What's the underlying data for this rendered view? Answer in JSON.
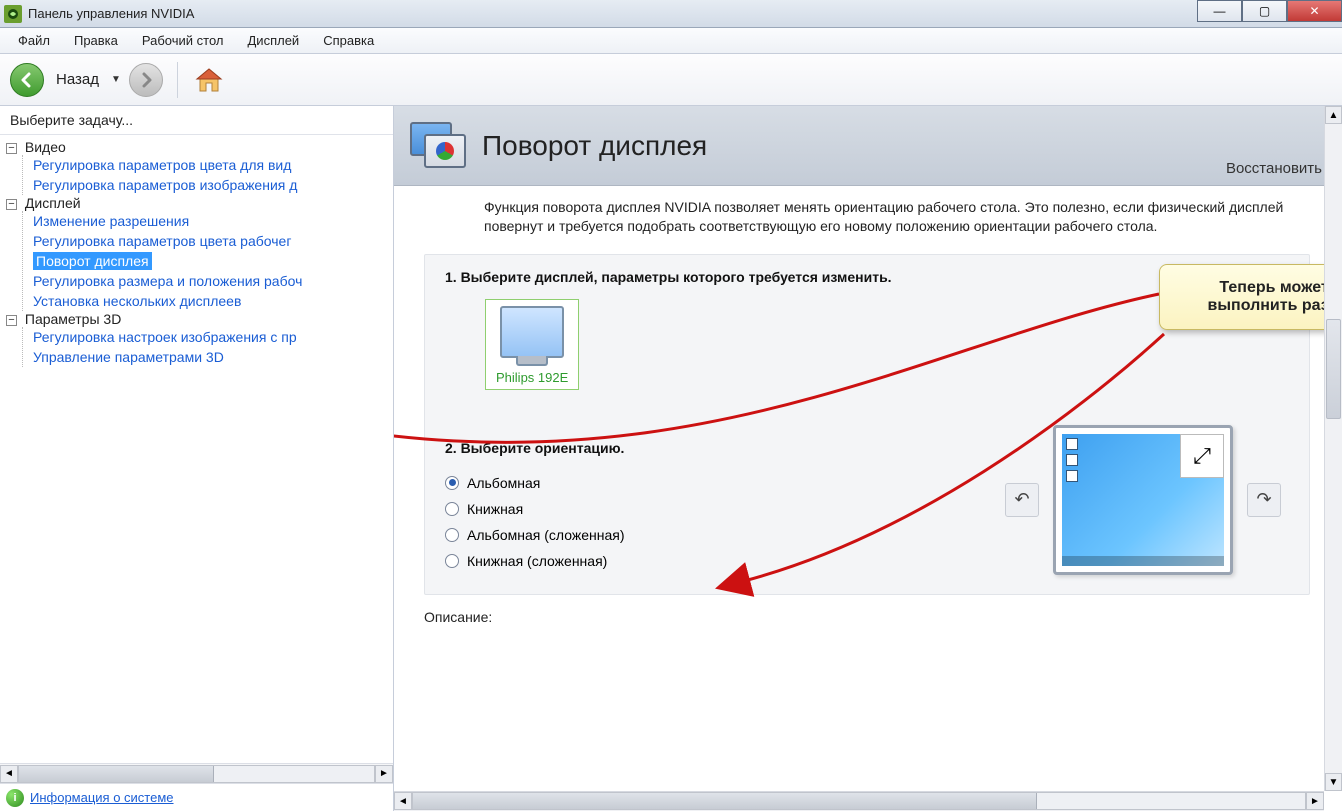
{
  "window": {
    "title": "Панель управления NVIDIA"
  },
  "menu": {
    "file": "Файл",
    "edit": "Правка",
    "desktop": "Рабочий стол",
    "display": "Дисплей",
    "help": "Справка"
  },
  "toolbar": {
    "back_label": "Назад"
  },
  "sidebar": {
    "task_header": "Выберите задачу...",
    "cat_video": "Видео",
    "video_color": "Регулировка параметров цвета для вид",
    "video_image": "Регулировка параметров изображения д",
    "cat_display": "Дисплей",
    "display_resolution": "Изменение разрешения",
    "display_color": "Регулировка параметров цвета рабочег",
    "display_rotate": "Поворот дисплея",
    "display_sizepos": "Регулировка размера и положения рабоч",
    "display_multi": "Установка нескольких дисплеев",
    "cat_3d": "Параметры 3D",
    "threeD_image": "Регулировка настроек изображения с пр",
    "threeD_manage": "Управление параметрами 3D",
    "system_info": "Информация о системе"
  },
  "main": {
    "page_title": "Поворот дисплея",
    "restore": "Восстановить",
    "description": "Функция поворота дисплея NVIDIA позволяет менять ориентацию рабочего стола. Это полезно, если физический дисплей повернут и требуется подобрать соответствующую его новому положению ориентации рабочего стола.",
    "section1_title": "1. Выберите дисплей, параметры которого требуется изменить.",
    "display_name": "Philips 192E",
    "section2_title": "2. Выберите ориентацию.",
    "orient_landscape": "Альбомная",
    "orient_portrait": "Книжная",
    "orient_landscape_flipped": "Альбомная (сложенная)",
    "orient_portrait_flipped": "Книжная (сложенная)",
    "description_label": "Описание:"
  },
  "callout": {
    "text": "Теперь можете с легкостью выполнить разворот десплея!"
  }
}
